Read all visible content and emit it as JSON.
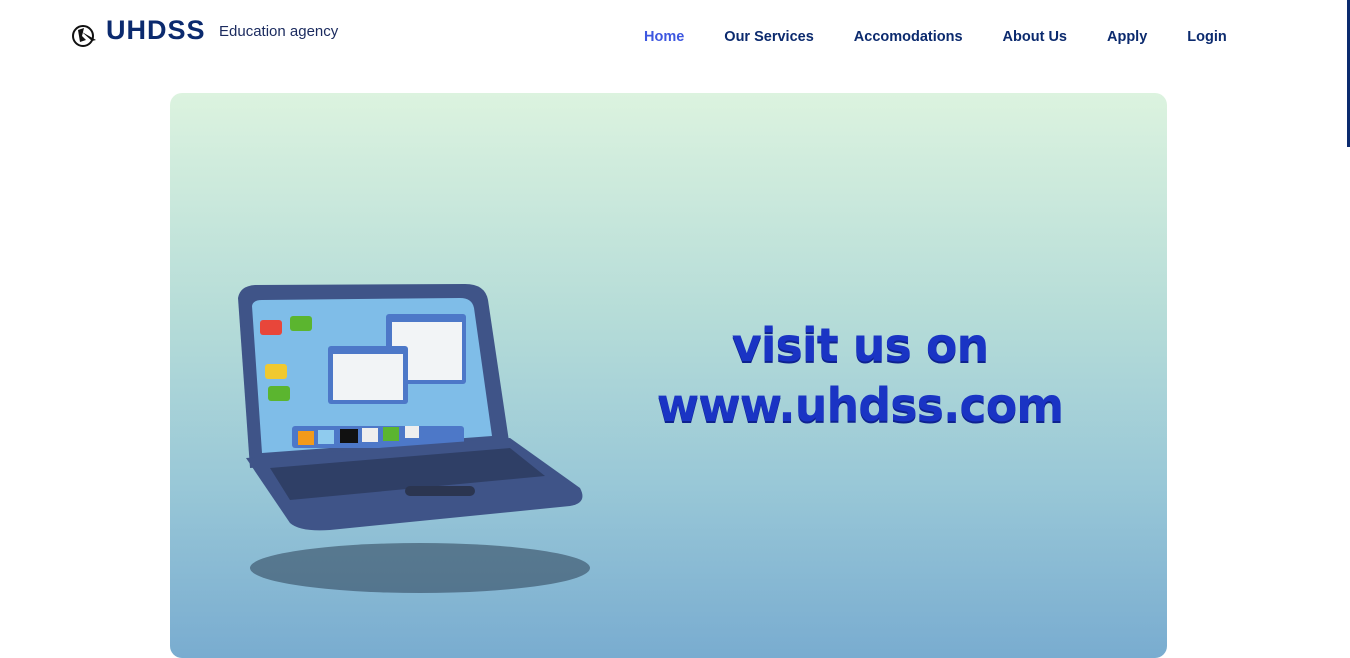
{
  "header": {
    "brand": "UHDSS",
    "tagline": "Education agency"
  },
  "nav": [
    {
      "label": "Home",
      "active": true
    },
    {
      "label": "Our Services"
    },
    {
      "label": "Accomodations"
    },
    {
      "label": "About Us"
    },
    {
      "label": "Apply"
    },
    {
      "label": "Login"
    }
  ],
  "hero": {
    "line1": "visit us on",
    "line2": "www.uhdss.com"
  }
}
